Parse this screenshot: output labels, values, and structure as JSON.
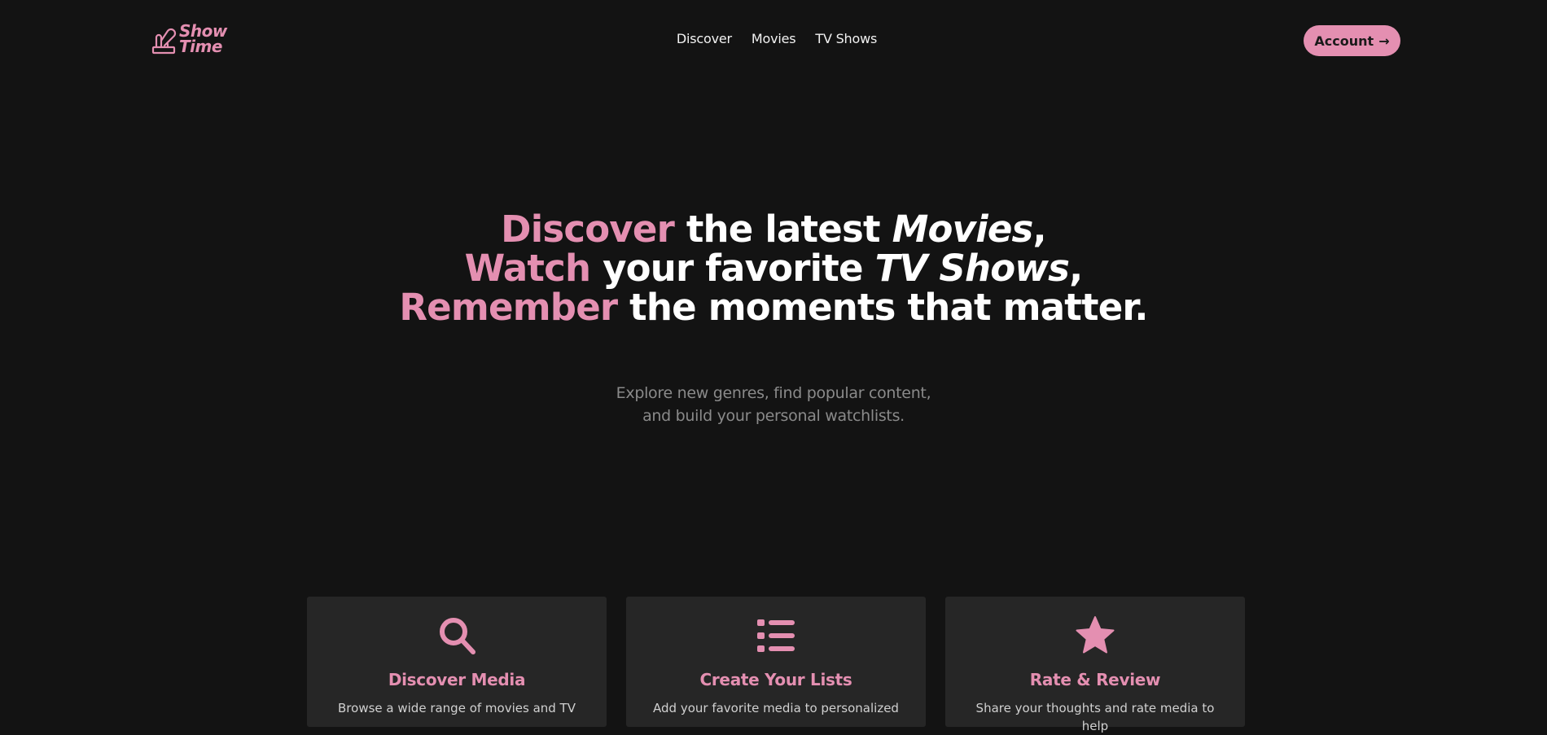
{
  "brand": {
    "name_line1": "Show",
    "name_line2": "Time",
    "accent_color": "#e48fb1",
    "background_color": "#131313",
    "card_color": "#262626"
  },
  "nav": {
    "items": [
      {
        "label": "Discover"
      },
      {
        "label": "Movies"
      },
      {
        "label": "TV Shows"
      }
    ]
  },
  "account_button": {
    "label": "Account",
    "arrow": "→"
  },
  "hero": {
    "line1": {
      "accent": "Discover",
      "text": " the latest ",
      "italic": "Movies",
      "end": ","
    },
    "line2": {
      "accent": "Watch",
      "text": " your favorite ",
      "italic": "TV Shows",
      "end": ","
    },
    "line3": {
      "accent": "Remember",
      "text": " the moments that matter."
    }
  },
  "subtitle": {
    "line1": "Explore new genres, find popular content,",
    "line2": "and build your personal watchlists."
  },
  "features": [
    {
      "icon": "search-icon",
      "title": "Discover Media",
      "text": "Browse a wide range of movies and TV"
    },
    {
      "icon": "list-icon",
      "title": "Create Your Lists",
      "text": "Add your favorite media to personalized"
    },
    {
      "icon": "star-icon",
      "title": "Rate & Review",
      "text": "Share your thoughts and rate media to help"
    }
  ]
}
